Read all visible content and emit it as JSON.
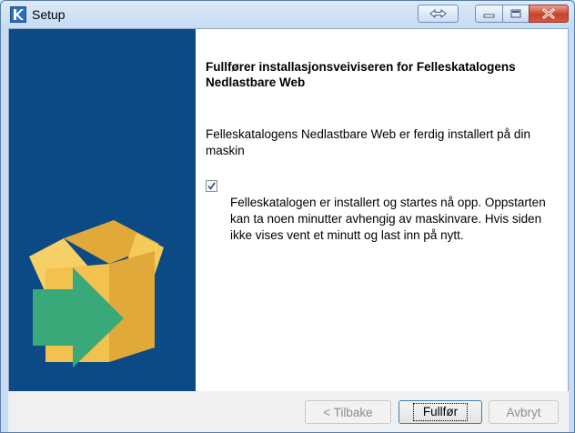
{
  "window": {
    "title": "Setup"
  },
  "titlebar": {
    "icons": [
      "app-icon",
      "restore-arrows-icon",
      "minimize-icon",
      "maximize-icon",
      "close-icon"
    ]
  },
  "content": {
    "heading": "Fullfører installasjonsveiviseren for Felleskatalogens Nedlastbare Web",
    "description": "Felleskatalogens Nedlastbare Web er ferdig installert på din maskin",
    "checkbox": {
      "checked": true,
      "text": "Felleskatalogen er installert og startes nå opp. Oppstarten kan ta noen minutter avhengig av maskinvare. Hvis siden ikke vises vent et minutt og last inn på nytt."
    }
  },
  "footer": {
    "back_label": "< Tilbake",
    "finish_label": "Fullfør",
    "cancel_label": "Avbryt"
  },
  "colors": {
    "side_panel": "#0b4a84",
    "box": "#f2c14e",
    "arrow": "#3aa97a",
    "close_button": "#c9412a"
  }
}
